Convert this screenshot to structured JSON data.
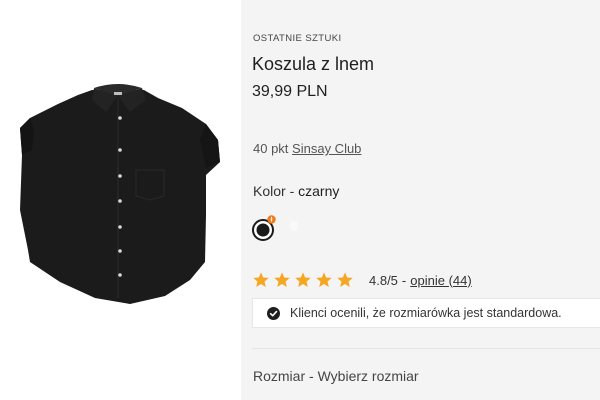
{
  "product": {
    "badge": "OSTATNIE SZTUKI",
    "name": "Koszula z lnem",
    "price": "39,99 PLN",
    "image_alt": "black linen shirt product image",
    "image_color": "#1b1b1b"
  },
  "loyalty": {
    "points": "40 pkt",
    "club_link": "Sinsay Club"
  },
  "color": {
    "label": "Kolor",
    "separator": "-",
    "value": "czarny",
    "swatch_icon": "color-swatch-black-selected",
    "swatch_color": "#1a1a1a",
    "indicator_color": "#f07a1a"
  },
  "rating": {
    "stars": 5,
    "star_color": "#f5a623",
    "score": "4.8/5",
    "separator": "-",
    "reviews_label": "opinie (44)"
  },
  "fit_notice": {
    "icon": "check-circle-icon",
    "text": "Klienci ocenili, że rozmiarówka jest standardowa."
  },
  "size": {
    "label": "Rozmiar",
    "separator": "-",
    "placeholder": "Wybierz rozmiar"
  }
}
